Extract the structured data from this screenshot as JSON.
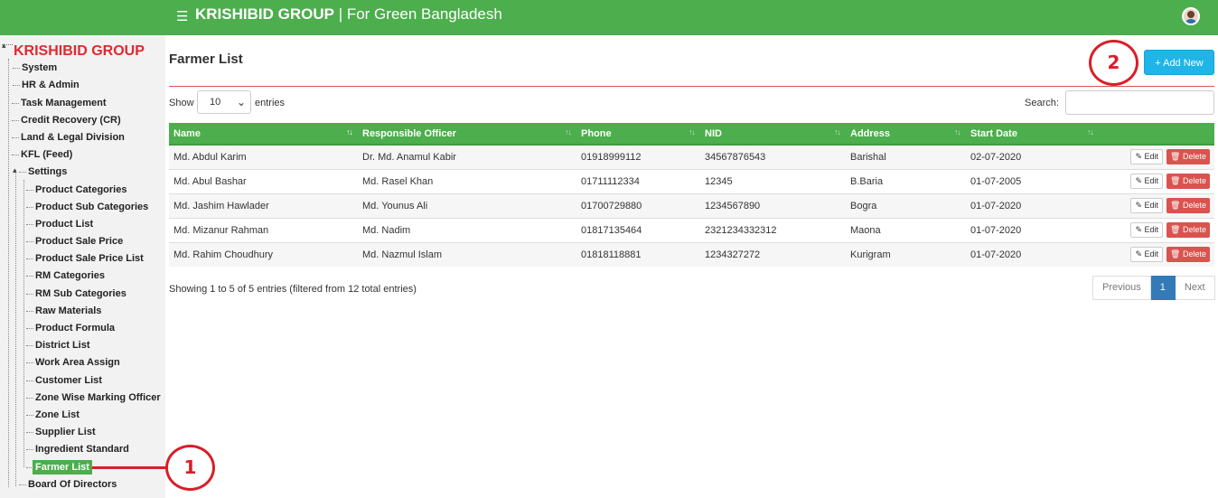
{
  "header": {
    "brand_bold": "KRISHIBID GROUP",
    "brand_rest": " | For Green Bangladesh",
    "menu_icon": "hamburger-icon",
    "avatar": "user-avatar"
  },
  "sidebar": {
    "title": "KRISHIBID GROUP",
    "items": [
      {
        "label": "System"
      },
      {
        "label": "HR & Admin"
      },
      {
        "label": "Task Management"
      },
      {
        "label": "Credit Recovery (CR)"
      },
      {
        "label": "Land & Legal Division"
      },
      {
        "label": "KFL (Feed)"
      },
      {
        "label": "Settings"
      },
      {
        "label": "Product Categories"
      },
      {
        "label": "Product Sub Categories"
      },
      {
        "label": "Product List"
      },
      {
        "label": "Product Sale Price"
      },
      {
        "label": "Product Sale Price List"
      },
      {
        "label": "RM Categories"
      },
      {
        "label": "RM Sub Categories"
      },
      {
        "label": "Raw Materials"
      },
      {
        "label": "Product Formula"
      },
      {
        "label": "District List"
      },
      {
        "label": "Work Area Assign"
      },
      {
        "label": "Customer List"
      },
      {
        "label": "Zone Wise Marking Officer"
      },
      {
        "label": "Zone List"
      },
      {
        "label": "Supplier List"
      },
      {
        "label": "Ingredient Standard"
      },
      {
        "label": "Farmer List",
        "active": true
      },
      {
        "label": "Board Of Directors"
      }
    ]
  },
  "main": {
    "title": "Farmer List",
    "add_new_label": "+ Add New",
    "show_label": "Show",
    "entries_value": "10",
    "entries_label": "entries",
    "search_label": "Search:",
    "columns": [
      "Name",
      "Responsible Officer",
      "Phone",
      "NID",
      "Address",
      "Start Date",
      ""
    ],
    "rows": [
      [
        "Md. Abdul Karim",
        "Dr. Md. Anamul Kabir",
        "01918999112",
        "34567876543",
        "Barishal",
        "02-07-2020"
      ],
      [
        "Md. Abul Bashar",
        "Md. Rasel Khan",
        "01711112334",
        "12345",
        "B.Baria",
        "01-07-2005"
      ],
      [
        "Md. Jashim Hawlader",
        "Md. Younus Ali",
        "01700729880",
        "1234567890",
        "Bogra",
        "01-07-2020"
      ],
      [
        "Md. Mizanur Rahman",
        "Md. Nadim",
        "01817135464",
        "2321234332312",
        "Maona",
        "01-07-2020"
      ],
      [
        "Md. Rahim Choudhury",
        "Md. Nazmul Islam",
        "01818118881",
        "1234327272",
        "Kurigram",
        "01-07-2020"
      ]
    ],
    "edit_label": "Edit",
    "delete_label": "Delete",
    "info_text": "Showing 1 to 5 of 5 entries (filtered from 12 total entries)",
    "pager": {
      "previous": "Previous",
      "current": "1",
      "next": "Next"
    }
  },
  "annotations": {
    "one": "1",
    "two": "2"
  }
}
